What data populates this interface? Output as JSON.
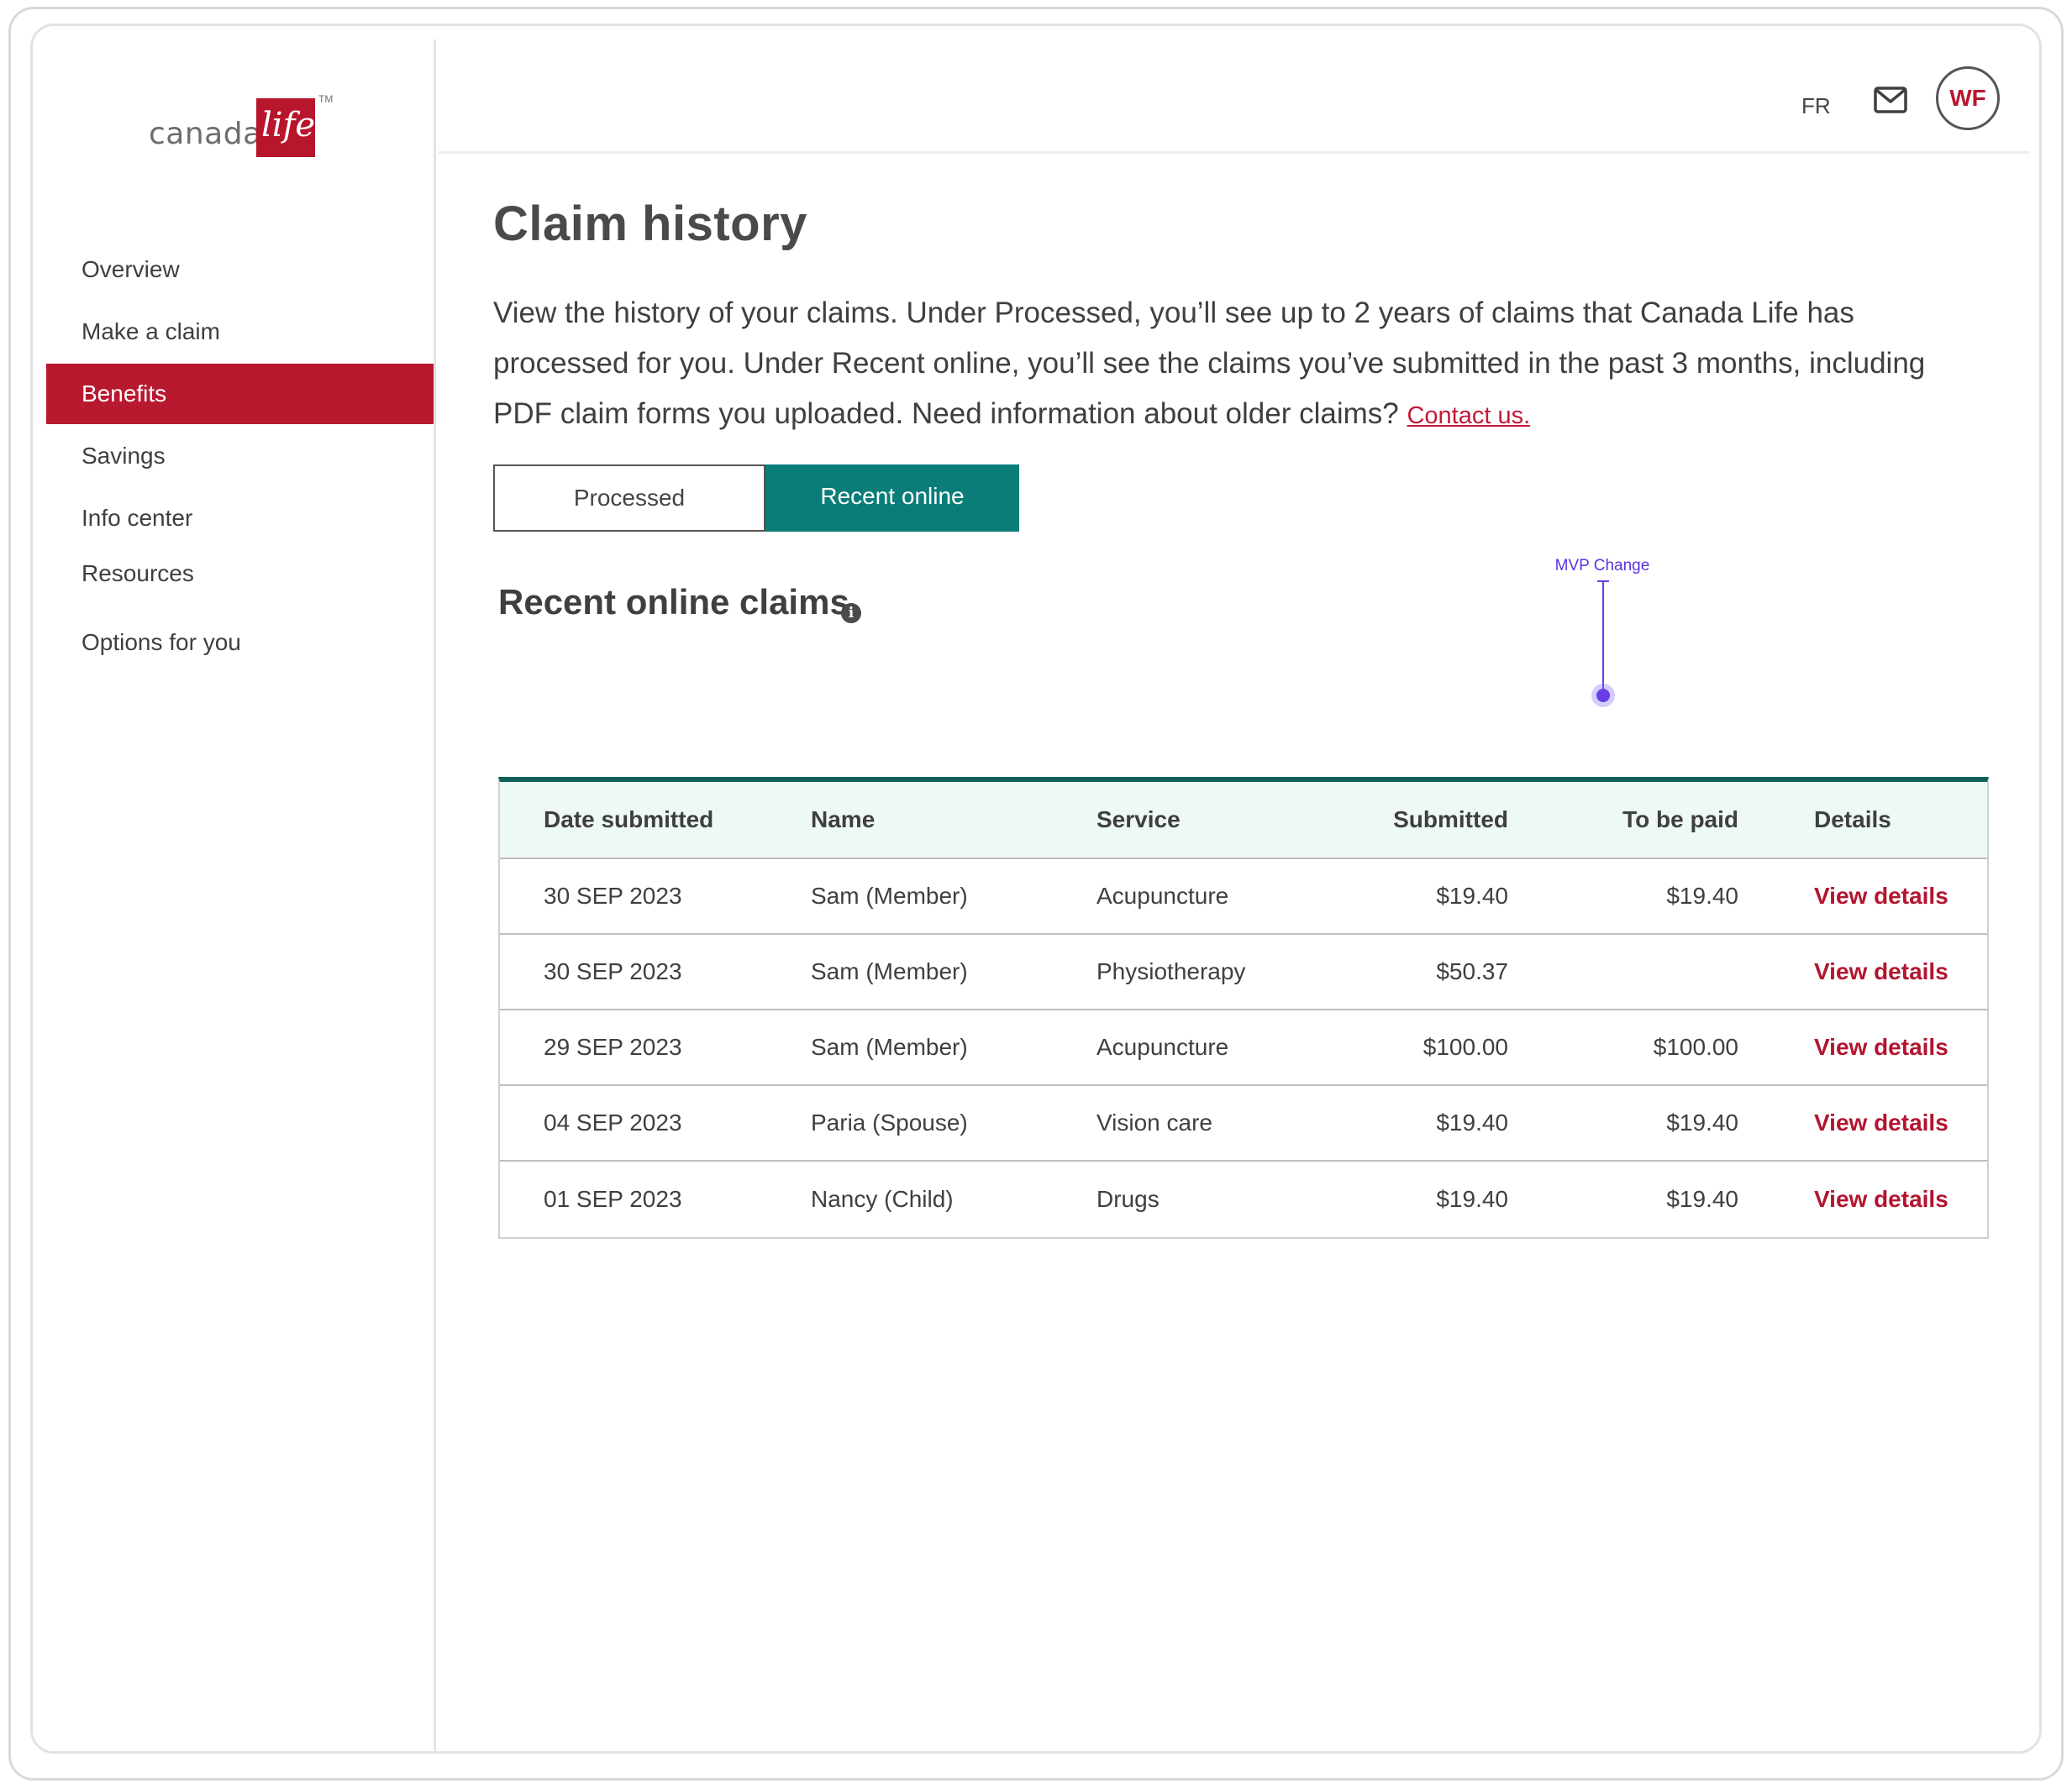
{
  "brand": {
    "word": "canada",
    "script": "life",
    "tm": "TM",
    "color": "#b8162c"
  },
  "sidebar": {
    "items": [
      {
        "label": "Overview",
        "active": false
      },
      {
        "label": "Make a claim",
        "active": false
      },
      {
        "label": "Benefits",
        "active": true
      },
      {
        "label": "Savings",
        "active": false
      },
      {
        "label": "Info center",
        "active": false
      },
      {
        "label": "Resources",
        "active": false
      },
      {
        "label": "Options for you",
        "active": false
      }
    ]
  },
  "header": {
    "lang": "FR",
    "mail_icon": "mail-icon",
    "avatar_initials": "WF"
  },
  "main": {
    "title": "Claim history",
    "intro": "View the history of your claims. Under Processed, you’ll see up to 2 years of claims that Canada Life has processed for you. Under Recent online, you’ll see the claims you’ve submitted in the past 3 months, including PDF claim forms you uploaded. Need information about older claims?",
    "contact_link": "Contact us.",
    "tabs": [
      {
        "label": "Processed",
        "selected": false
      },
      {
        "label": "Recent online",
        "selected": true
      }
    ],
    "section_title": "Recent online claims",
    "info_icon": "info-icon",
    "annotation": "MVP Change",
    "accent_color": "#0b7d79"
  },
  "table": {
    "headers": [
      "Date submitted",
      "Name",
      "Service",
      "Submitted",
      "To be paid",
      "Details"
    ],
    "rows": [
      {
        "date": "30 SEP 2023",
        "name": "Sam (Member)",
        "service": "Acupuncture",
        "submitted": "$19.40",
        "to_be_paid": "$19.40",
        "details": "View details"
      },
      {
        "date": "30 SEP 2023",
        "name": "Sam (Member)",
        "service": "Physiotherapy",
        "submitted": "$50.37",
        "to_be_paid": "",
        "details": "View details"
      },
      {
        "date": "29 SEP 2023",
        "name": "Sam (Member)",
        "service": "Acupuncture",
        "submitted": "$100.00",
        "to_be_paid": "$100.00",
        "details": "View details"
      },
      {
        "date": "04 SEP 2023",
        "name": "Paria (Spouse)",
        "service": "Vision care",
        "submitted": "$19.40",
        "to_be_paid": "$19.40",
        "details": "View details"
      },
      {
        "date": "01 SEP 2023",
        "name": "Nancy (Child)",
        "service": "Drugs",
        "submitted": "$19.40",
        "to_be_paid": "$19.40",
        "details": "View details"
      }
    ]
  }
}
